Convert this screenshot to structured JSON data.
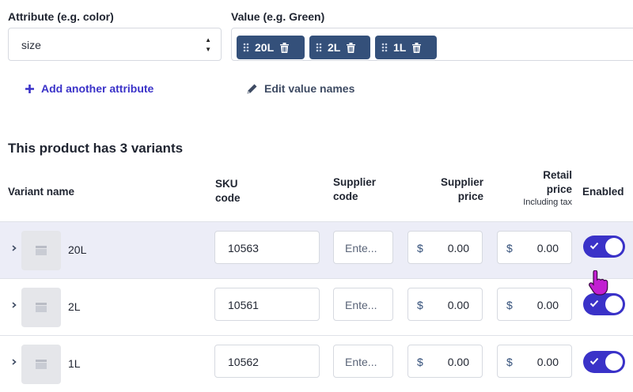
{
  "attribute": {
    "label": "Attribute (e.g. color)",
    "value": "size"
  },
  "values": {
    "label": "Value (e.g. Green)",
    "chips": [
      "20L",
      "2L",
      "1L"
    ]
  },
  "actions": {
    "add_attribute": "Add another attribute",
    "edit_names": "Edit value names"
  },
  "variants_heading": "This product has 3 variants",
  "table": {
    "headers": {
      "variant_name": "Variant name",
      "sku_1": "SKU",
      "sku_2": "code",
      "supplier_code_1": "Supplier",
      "supplier_code_2": "code",
      "supplier_price_1": "Supplier",
      "supplier_price_2": "price",
      "retail_price_1": "Retail",
      "retail_price_2": "price",
      "retail_price_note": "Including tax",
      "enabled": "Enabled"
    },
    "currency": "$",
    "supplier_code_placeholder": "Ente...",
    "rows": [
      {
        "name": "20L",
        "sku": "10563",
        "supplier_price": "0.00",
        "retail_price": "0.00",
        "enabled": true
      },
      {
        "name": "2L",
        "sku": "10561",
        "supplier_price": "0.00",
        "retail_price": "0.00",
        "enabled": true
      },
      {
        "name": "1L",
        "sku": "10562",
        "supplier_price": "0.00",
        "retail_price": "0.00",
        "enabled": true
      }
    ]
  },
  "colors": {
    "accent": "#3a32c8",
    "chip": "#34507a",
    "selected_row": "#ecedf7",
    "cursor": "#c21fd1"
  }
}
